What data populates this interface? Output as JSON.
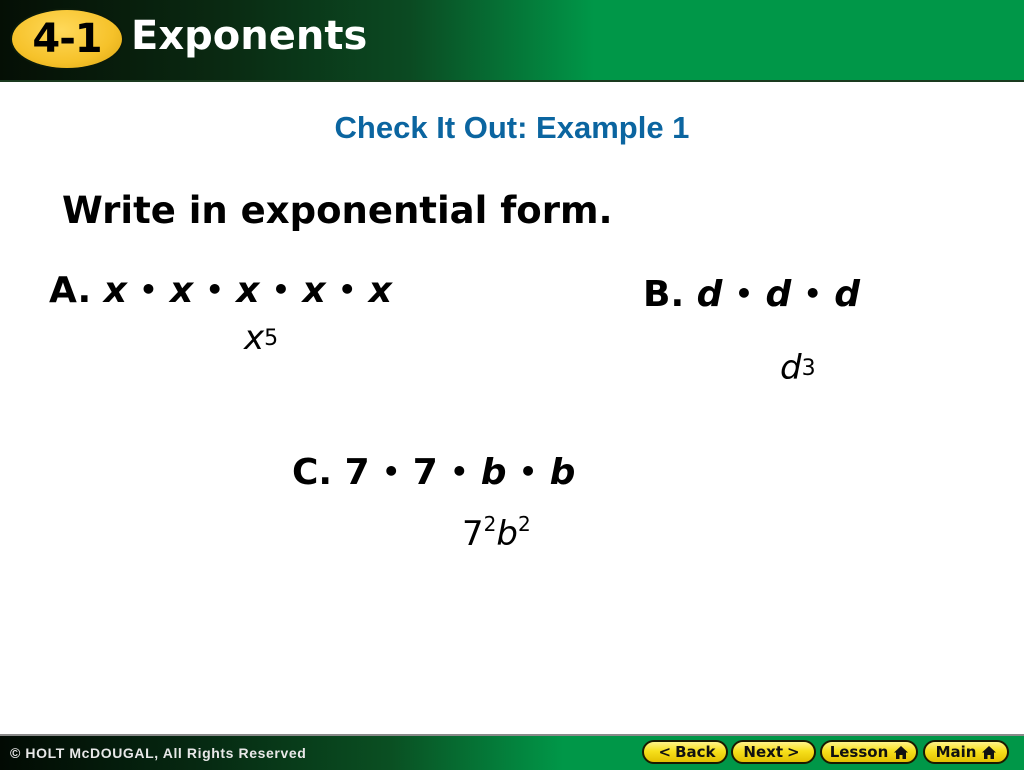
{
  "header": {
    "lesson_number": "4-1",
    "title": "Exponents"
  },
  "subtitle": "Check It Out: Example 1",
  "instruction": "Write in exponential form.",
  "problems": {
    "a": {
      "label": "A.",
      "factors": [
        "x",
        "x",
        "x",
        "x",
        "x"
      ],
      "separator": "•",
      "answer_base": "x",
      "answer_exponent": "5"
    },
    "b": {
      "label": "B.",
      "factors": [
        "d",
        "d",
        "d"
      ],
      "separator": "•",
      "answer_base": "d",
      "answer_exponent": "3"
    },
    "c": {
      "label": "C.",
      "factors": [
        "7",
        "7",
        "b",
        "b"
      ],
      "separator": "•",
      "answer_base1": "7",
      "answer_exponent1": "2",
      "answer_base2": "b",
      "answer_exponent2": "2"
    }
  },
  "footer": {
    "copyright": "© HOLT McDOUGAL, All Rights Reserved",
    "buttons": {
      "back": {
        "label": "Back",
        "icon": "chevron-left-icon",
        "glyph": "<"
      },
      "next": {
        "label": "Next",
        "icon": "chevron-right-icon",
        "glyph": ">"
      },
      "lesson": {
        "label": "Lesson",
        "icon": "home-icon"
      },
      "main": {
        "label": "Main",
        "icon": "home-icon"
      }
    }
  },
  "colors": {
    "header_green": "#009748",
    "badge_yellow": "#f6c22a",
    "subtitle_blue": "#0b65a0",
    "button_yellow": "#f7e01c"
  }
}
